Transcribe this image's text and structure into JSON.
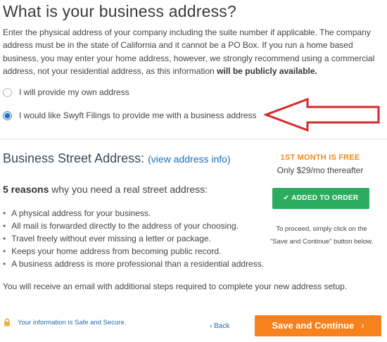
{
  "page": {
    "title": "What is your business address?",
    "intro_part1": "Enter the physical address of your company including the suite number if applicable. The company address must be in the state of California and it cannot be a PO Box. If you run a home based business, you may enter your home address, however, we strongly recommend using a commercial address, not your residential address, as this information ",
    "intro_bold": "will be publicly available."
  },
  "options": [
    {
      "label": "I will provide my own address",
      "selected": false
    },
    {
      "label": "I would like Swyft Filings to provide me with a business address",
      "selected": true
    }
  ],
  "street": {
    "heading": "Business Street Address:",
    "link_open": "(",
    "link": "view address info",
    "link_close": ")",
    "reasons_bold": "5 reasons",
    "reasons_rest": " why you need a real street address:",
    "bullets": [
      "A physical address for your business.",
      "All mail is forwarded directly to the address of your choosing.",
      "Travel freely without ever missing a letter or package.",
      "Keeps your home address from becoming public record.",
      "A business address is more professional than a residential address."
    ],
    "email_note": "You will receive an email with additional steps required to complete your new address setup."
  },
  "offer": {
    "promo": "1ST MONTH IS FREE",
    "price": "Only $29/mo thereafter",
    "added_label": "ADDED TO ORDER",
    "proceed_line1": "To proceed, simply click on the",
    "proceed_line2": "\"Save and Continue\" button below."
  },
  "footer": {
    "secure_text": "Your information is Safe and Secure.",
    "back_label": "Back",
    "save_label": "Save and Continue"
  },
  "colors": {
    "accent_orange": "#f7811c",
    "added_green": "#2cac5e",
    "link_blue": "#1a6fb8",
    "annotation_arrow": "#d42a2a"
  },
  "icons": {
    "back": "chevron-left-icon",
    "save": "chevron-right-icon",
    "lock": "lock-icon",
    "check": "check-icon"
  }
}
